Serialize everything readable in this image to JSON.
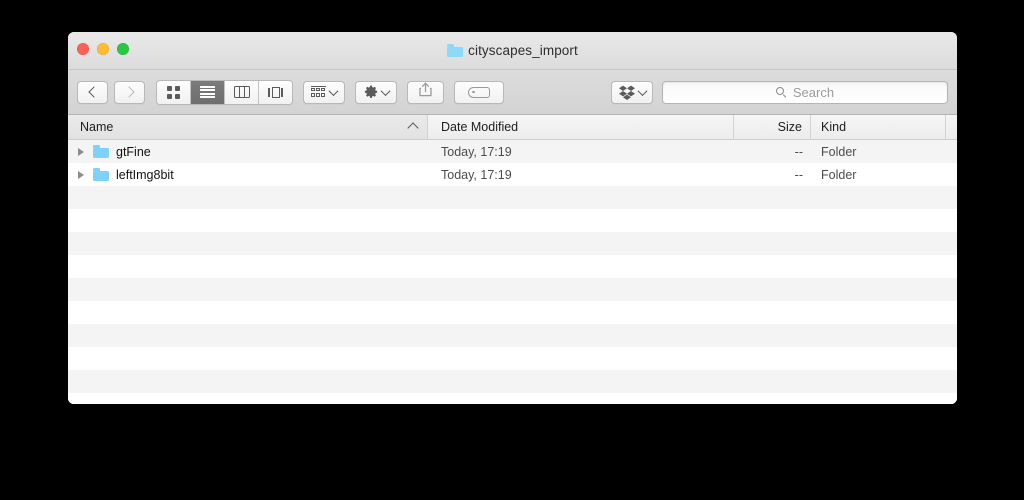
{
  "window": {
    "title": "cityscapes_import",
    "title_icon": "folder-icon",
    "traffic_lights": {
      "close_color": "#ff5f57",
      "minimize_color": "#febc2e",
      "zoom_color": "#28c840"
    }
  },
  "toolbar": {
    "back_label": "Back",
    "forward_label": "Forward",
    "view_modes": [
      {
        "name": "icon-view",
        "label": "Icon View",
        "selected": false
      },
      {
        "name": "list-view",
        "label": "List View",
        "selected": true
      },
      {
        "name": "column-view",
        "label": "Column View",
        "selected": false
      },
      {
        "name": "gallery-view",
        "label": "Cover Flow View",
        "selected": false
      }
    ],
    "arrange_label": "Arrange",
    "action_label": "Action",
    "share_label": "Share",
    "tag_label": "Tags",
    "dropbox_label": "Dropbox"
  },
  "search": {
    "placeholder": "Search",
    "value": ""
  },
  "columns": [
    {
      "key": "name",
      "label": "Name",
      "sorted": true,
      "sort_direction": "ascending"
    },
    {
      "key": "date",
      "label": "Date Modified",
      "sorted": false
    },
    {
      "key": "size",
      "label": "Size",
      "sorted": false
    },
    {
      "key": "kind",
      "label": "Kind",
      "sorted": false
    }
  ],
  "files": [
    {
      "name": "gtFine",
      "date_modified": "Today, 17:19",
      "size": "--",
      "kind": "Folder",
      "expanded": false
    },
    {
      "name": "leftImg8bit",
      "date_modified": "Today, 17:19",
      "size": "--",
      "kind": "Folder",
      "expanded": false
    }
  ],
  "empty_row_count": 10
}
